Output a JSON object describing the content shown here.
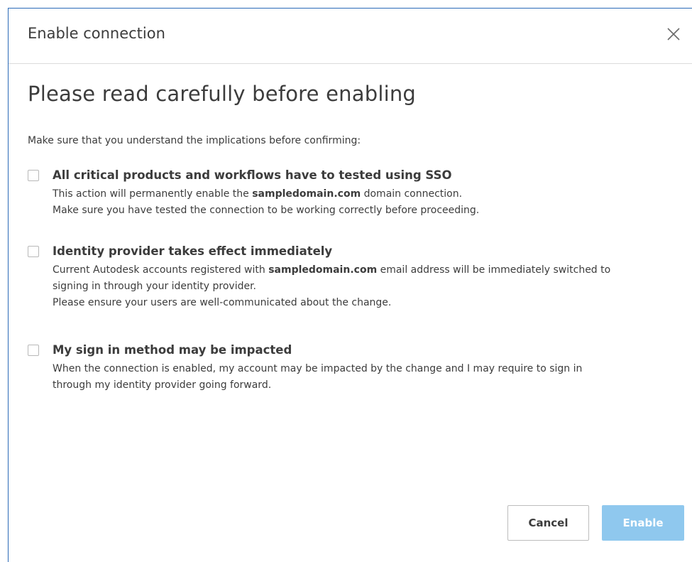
{
  "dialog": {
    "title": "Enable connection",
    "close_icon": "close-icon"
  },
  "heading": "Please read carefully before enabling",
  "intro": "Make sure that you understand the implications before confirming:",
  "options": [
    {
      "checked": false,
      "title": "All critical products and workflows have to tested using SSO",
      "lines": [
        [
          "This action will permanently enable the ",
          "sampledomain.com",
          " domain connection."
        ],
        [
          "Make sure you have tested the connection to be working correctly before proceeding.",
          "",
          ""
        ]
      ]
    },
    {
      "checked": false,
      "title": "Identity provider takes effect immediately",
      "lines": [
        [
          "Current Autodesk accounts registered with ",
          "sampledomain.com",
          " email address will be immediately switched to"
        ],
        [
          "signing in through your identity provider.",
          "",
          ""
        ],
        [
          "Please ensure your users are well-communicated about the change.",
          "",
          ""
        ]
      ]
    },
    {
      "checked": false,
      "title": "My sign in method may be impacted",
      "lines": [
        [
          "When the connection is enabled, my account may be impacted by the change and I may require to sign in",
          "",
          ""
        ],
        [
          "through my identity provider going forward.",
          "",
          ""
        ]
      ]
    }
  ],
  "buttons": {
    "cancel": "Cancel",
    "enable": "Enable"
  },
  "colors": {
    "accent_border": "#2b6ab8",
    "enable_button_disabled": "#8fc8ee",
    "text": "#3c3c3c"
  }
}
